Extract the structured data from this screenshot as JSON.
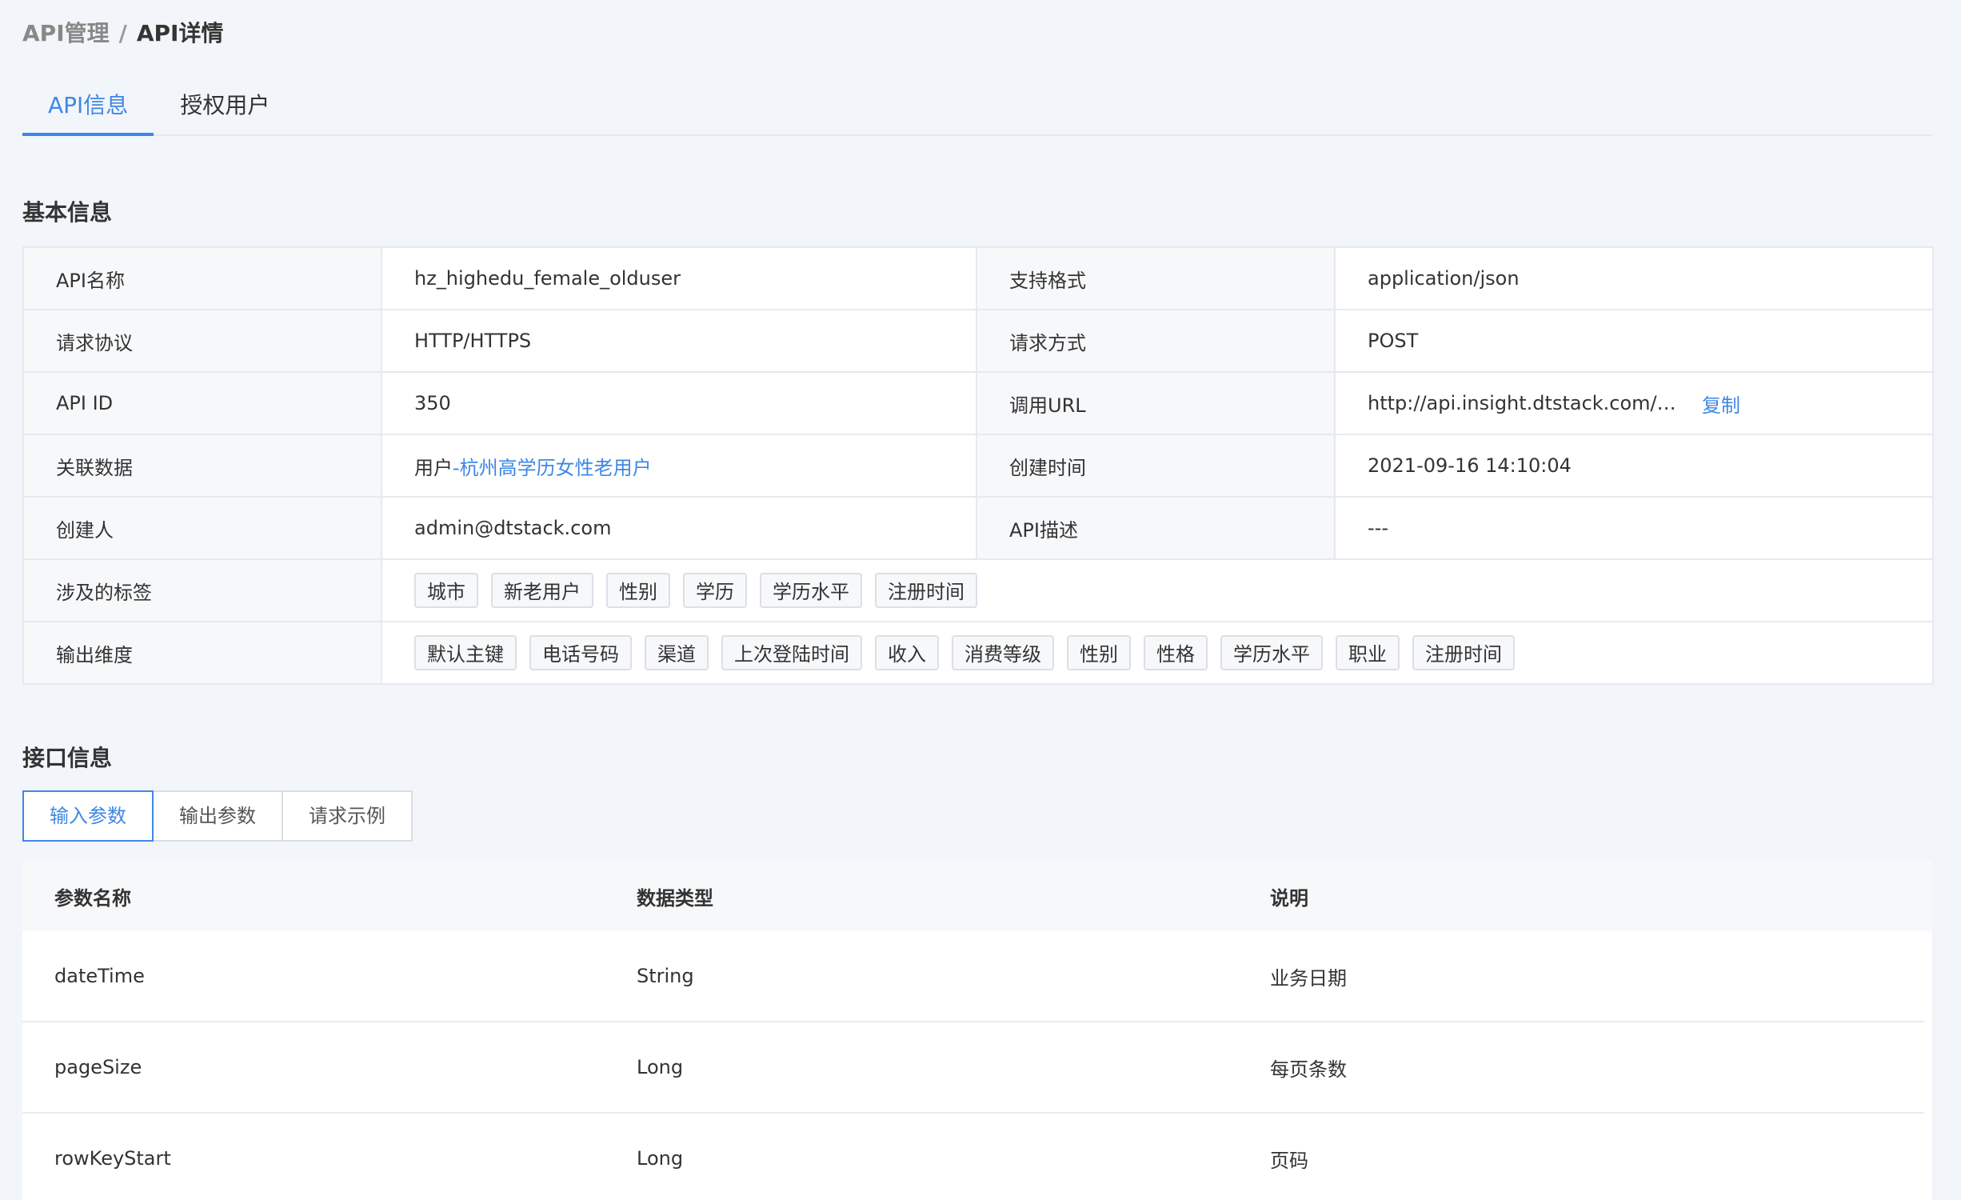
{
  "breadcrumb": {
    "parent": "API管理",
    "separator": "/",
    "current": "API详情"
  },
  "top_tabs": [
    {
      "label": "API信息",
      "active": true
    },
    {
      "label": "授权用户",
      "active": false
    }
  ],
  "sections": {
    "basic_title": "基本信息",
    "interface_title": "接口信息"
  },
  "basic_info": {
    "api_name_label": "API名称",
    "api_name": "hz_highedu_female_olduser",
    "format_label": "支持格式",
    "format": "application/json",
    "protocol_label": "请求协议",
    "protocol": "HTTP/HTTPS",
    "method_label": "请求方式",
    "method": "POST",
    "api_id_label": "API ID",
    "api_id": "350",
    "url_label": "调用URL",
    "url": "http://api.insight.dtstack.com/api/...",
    "copy_label": "复制",
    "related_label": "关联数据",
    "related_prefix": "用户",
    "related_link": "-杭州高学历女性老用户",
    "created_time_label": "创建时间",
    "created_time": "2021-09-16 14:10:04",
    "creator_label": "创建人",
    "creator": "admin@dtstack.com",
    "desc_label": "API描述",
    "desc": "---",
    "tags_label": "涉及的标签",
    "tags": [
      "城市",
      "新老用户",
      "性别",
      "学历",
      "学历水平",
      "注册时间"
    ],
    "dims_label": "输出维度",
    "dims": [
      "默认主键",
      "电话号码",
      "渠道",
      "上次登陆时间",
      "收入",
      "消费等级",
      "性别",
      "性格",
      "学历水平",
      "职业",
      "注册时间"
    ]
  },
  "sub_tabs": [
    {
      "label": "输入参数",
      "active": true
    },
    {
      "label": "输出参数",
      "active": false
    },
    {
      "label": "请求示例",
      "active": false
    }
  ],
  "params": {
    "headers": [
      "参数名称",
      "数据类型",
      "说明"
    ],
    "rows": [
      [
        "dateTime",
        "String",
        "业务日期"
      ],
      [
        "pageSize",
        "Long",
        "每页条数"
      ],
      [
        "rowKeyStart",
        "Long",
        "页码"
      ]
    ]
  }
}
